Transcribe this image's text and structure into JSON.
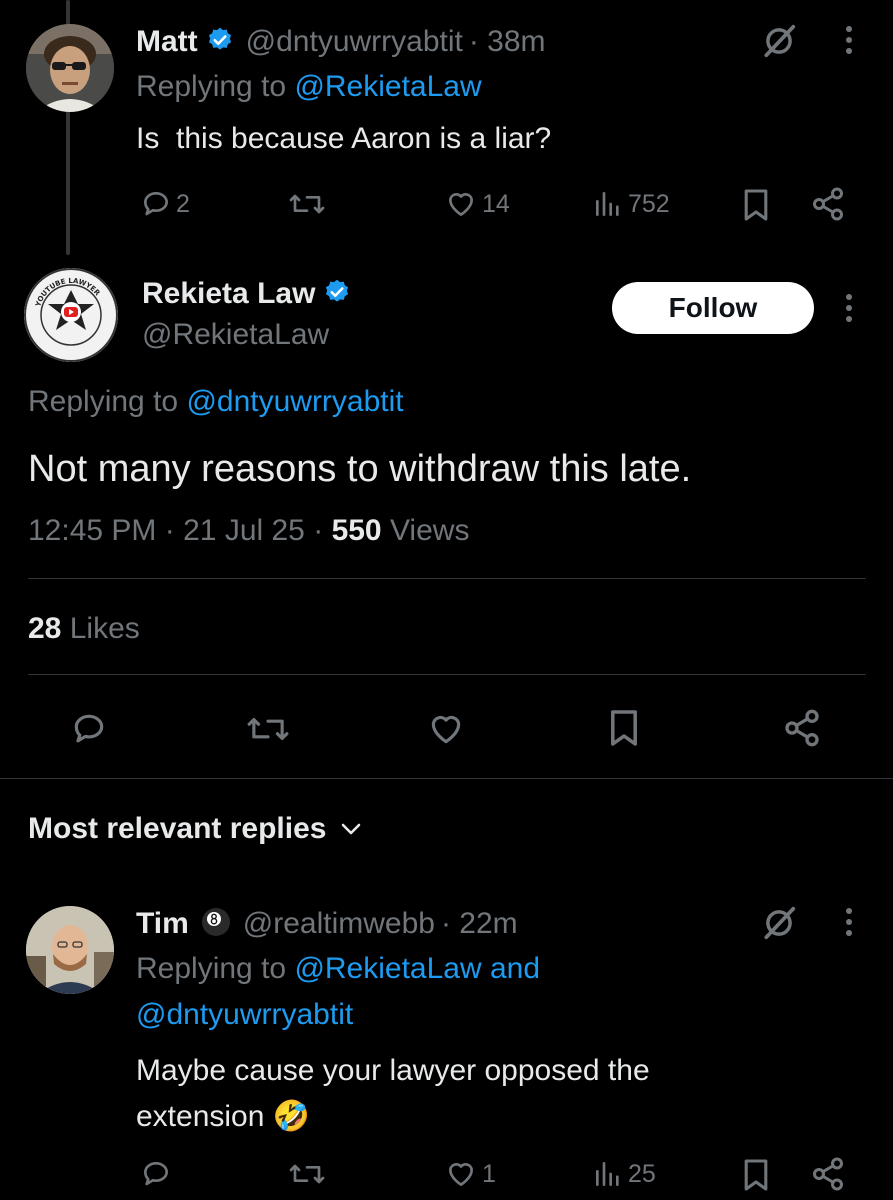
{
  "reply1": {
    "name": "Matt",
    "handle": "@dntyuwrryabtit",
    "time": "· 38m",
    "replying_prefix": "Replying to",
    "replying_to": "@RekietaLaw",
    "text": "Is  this because Aaron is a liar?",
    "stats": {
      "replies": "2",
      "likes": "14",
      "views": "752"
    }
  },
  "main_tweet": {
    "name": "Rekieta Law",
    "handle": "@RekietaLaw",
    "follow_label": "Follow",
    "replying_prefix": "Replying to",
    "replying_to": "@dntyuwrryabtit",
    "text": "Not many reasons to withdraw this late.",
    "time": "12:45 PM",
    "date": "21 Jul 25",
    "views_count": "550",
    "views_label": "Views",
    "likes_count": "28",
    "likes_label": "Likes",
    "avatar_text_top": "YOUTUBE LAWYER",
    "avatar_text_bottom": "INTOXICATION & LITIGATION"
  },
  "replies_header": {
    "label": "Most relevant replies"
  },
  "reply2": {
    "name": "Tim",
    "handle": "@realtimwebb",
    "time": "· 22m",
    "replying_prefix": "Replying to",
    "replying_to_1": "@RekietaLaw",
    "replying_and": "and",
    "replying_to_2": "@dntyuwrryabtit",
    "text_line1": "Maybe cause your lawyer opposed the",
    "text_line2": "extension",
    "emoji": "🤣",
    "stats": {
      "likes": "1",
      "views": "25"
    }
  },
  "colors": {
    "background": "#000000",
    "text": "#e7e9ea",
    "secondary": "#71767b",
    "link": "#1d9bf0",
    "verified": "#1d9bf0"
  }
}
